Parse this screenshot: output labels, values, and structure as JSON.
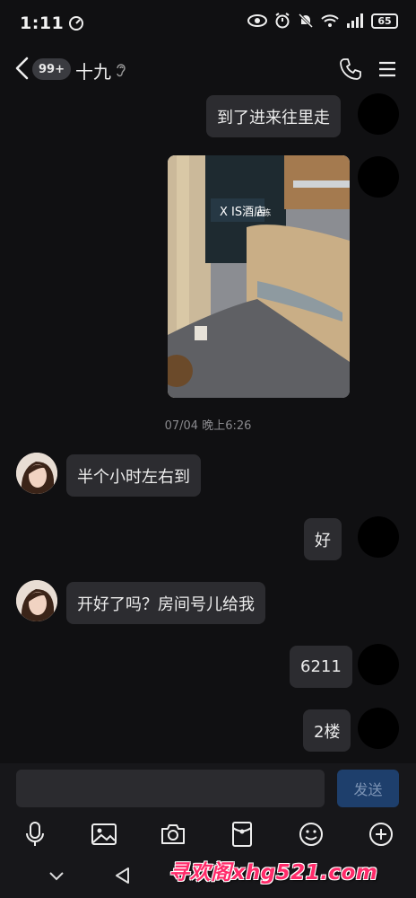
{
  "status_bar": {
    "time": "1:11",
    "battery": "65"
  },
  "header": {
    "unread_badge": "99+",
    "chat_name": "十九"
  },
  "messages": [
    {
      "side": "self",
      "text": "到了进来往里走"
    },
    {
      "side": "self",
      "type": "image",
      "sign_text": "X IS酒店",
      "sign_sub": "B栋"
    },
    {
      "type": "timestamp",
      "text": "07/04 晚上6:26"
    },
    {
      "side": "peer",
      "text": "半个小时左右到"
    },
    {
      "side": "self",
      "text": "好"
    },
    {
      "side": "peer",
      "text": "开好了吗？房间号儿给我"
    },
    {
      "side": "self",
      "text": "6211"
    },
    {
      "side": "self",
      "text": "2楼"
    }
  ],
  "composer": {
    "input_value": "",
    "send_label": "发送"
  },
  "toolbar_icons": [
    "mic-icon",
    "image-icon",
    "camera-icon",
    "red-packet-icon",
    "emoji-icon",
    "plus-icon"
  ],
  "watermark": "寻欢阁xhg521.com",
  "colors": {
    "background": "#101012",
    "bubble": "#2c2c30",
    "send_button": "#1e3f6c",
    "watermark": "#ff2b6a"
  }
}
